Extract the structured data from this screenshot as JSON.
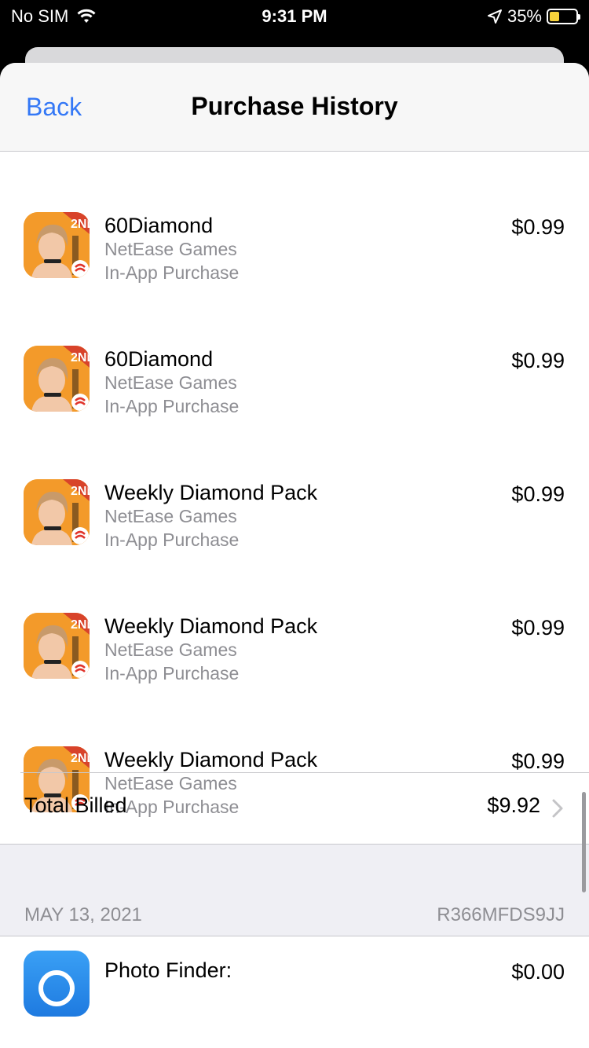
{
  "status_bar": {
    "carrier": "No SIM",
    "time": "9:31 PM",
    "battery": "35%"
  },
  "nav": {
    "back_label": "Back",
    "title": "Purchase History"
  },
  "items": [
    {
      "name": "60Diamond",
      "developer": "NetEase Games",
      "type": "In-App Purchase",
      "price": "$0.99"
    },
    {
      "name": "60Diamond",
      "developer": "NetEase Games",
      "type": "In-App Purchase",
      "price": "$0.99"
    },
    {
      "name": "Weekly Diamond Pack",
      "developer": "NetEase Games",
      "type": "In-App Purchase",
      "price": "$0.99"
    },
    {
      "name": "Weekly Diamond Pack",
      "developer": "NetEase Games",
      "type": "In-App Purchase",
      "price": "$0.99"
    },
    {
      "name": "Weekly Diamond Pack",
      "developer": "NetEase Games",
      "type": "In-App Purchase",
      "price": "$0.99"
    }
  ],
  "total": {
    "label": "Total Billed",
    "value": "$9.92"
  },
  "next_section": {
    "date": "MAY 13, 2021",
    "order_id": "R366MFDS9JJ",
    "first_item_name": "Photo Finder:",
    "first_item_price": "$0.00"
  },
  "icons": {
    "app_icon": "game-app-icon",
    "finder_icon": "photo-finder-app-icon"
  }
}
